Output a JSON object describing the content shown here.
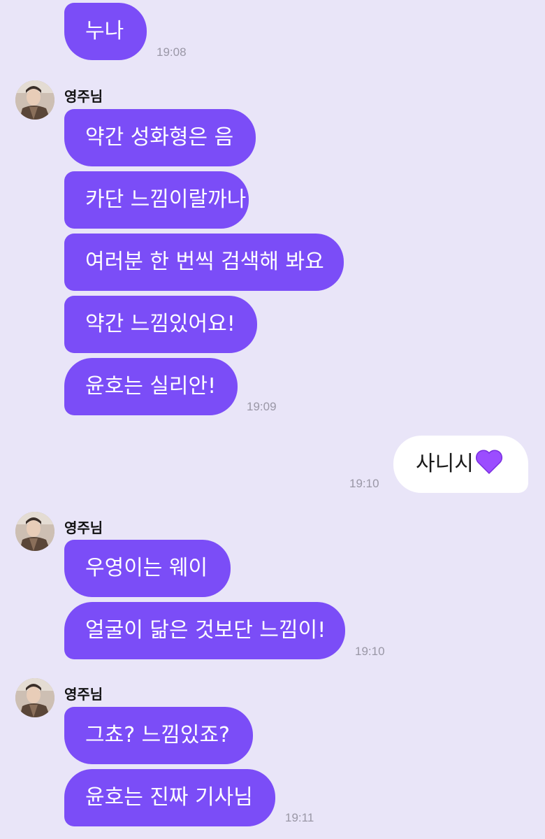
{
  "colors": {
    "background": "#E9E5F8",
    "their_bubble": "#7B4DF7",
    "my_bubble": "#FFFFFF",
    "timestamp": "#9A97A6",
    "heart": "#9B4DFF"
  },
  "messages": [
    {
      "text": "누나",
      "time": "19:08"
    },
    {
      "sender": "영주님",
      "texts": [
        "약간 성화형은 음",
        "카단 느낌이랄까나",
        "여러분 한 번씩 검색해 봐요",
        "약간 느낌있어요!",
        "윤호는 실리안!"
      ],
      "time": "19:09"
    },
    {
      "text": "사니시",
      "emoji": "purple-heart-icon",
      "time": "19:10"
    },
    {
      "sender": "영주님",
      "texts": [
        "우영이는 웨이",
        "얼굴이 닮은 것보단 느낌이!"
      ],
      "time": "19:10"
    },
    {
      "sender": "영주님",
      "texts": [
        "그쵸? 느낌있죠?",
        "윤호는 진짜 기사님"
      ],
      "time": "19:11"
    }
  ]
}
